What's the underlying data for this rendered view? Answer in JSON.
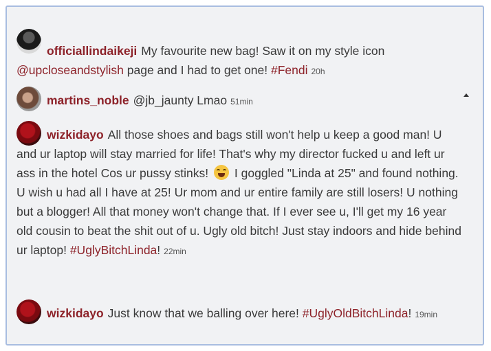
{
  "comments": [
    {
      "username": "officiallindaikeji",
      "parts": [
        {
          "t": "My favourite new bag! Saw it on my style icon "
        },
        {
          "m": "@upcloseandstylish"
        },
        {
          "t": " page and I had to get one! "
        },
        {
          "h": "#Fendi"
        }
      ],
      "time": "20h"
    },
    {
      "username": "martins_noble",
      "parts": [
        {
          "t": "@jb_jaunty Lmao"
        }
      ],
      "time": "51min"
    },
    {
      "username": "wizkidayo",
      "parts": [
        {
          "t": "All those shoes and bags still won't help u keep a good man! U and ur laptop will stay married for life! That's why my director fucked u and left ur ass in the hotel Cos ur pussy stinks! "
        },
        {
          "e": "joy-emoji"
        },
        {
          "t": " I goggled \"Linda at 25\" and found nothing. U wish u had all I have at 25! Ur mom and ur entire family are still losers! U nothing but a blogger! All that money won't change that. If I ever see u, I'll get my 16 year old cousin to beat the shit out of u. Ugly old bitch! Just stay indoors and hide behind ur laptop! "
        },
        {
          "h": "#UglyBitchLinda"
        },
        {
          "t": "!"
        }
      ],
      "time": "22min"
    },
    {
      "username": "wizkidayo",
      "parts": [
        {
          "t": "Just know that we balling over here! "
        },
        {
          "h": "#UglyOldBitchLinda"
        },
        {
          "t": "!"
        }
      ],
      "time": "19min"
    }
  ],
  "colors": {
    "username": "#8d2229",
    "hashtag": "#8d2229",
    "text": "#3a3a3a",
    "panel_bg": "#f1f2f4",
    "panel_border": "#a8bde0"
  }
}
